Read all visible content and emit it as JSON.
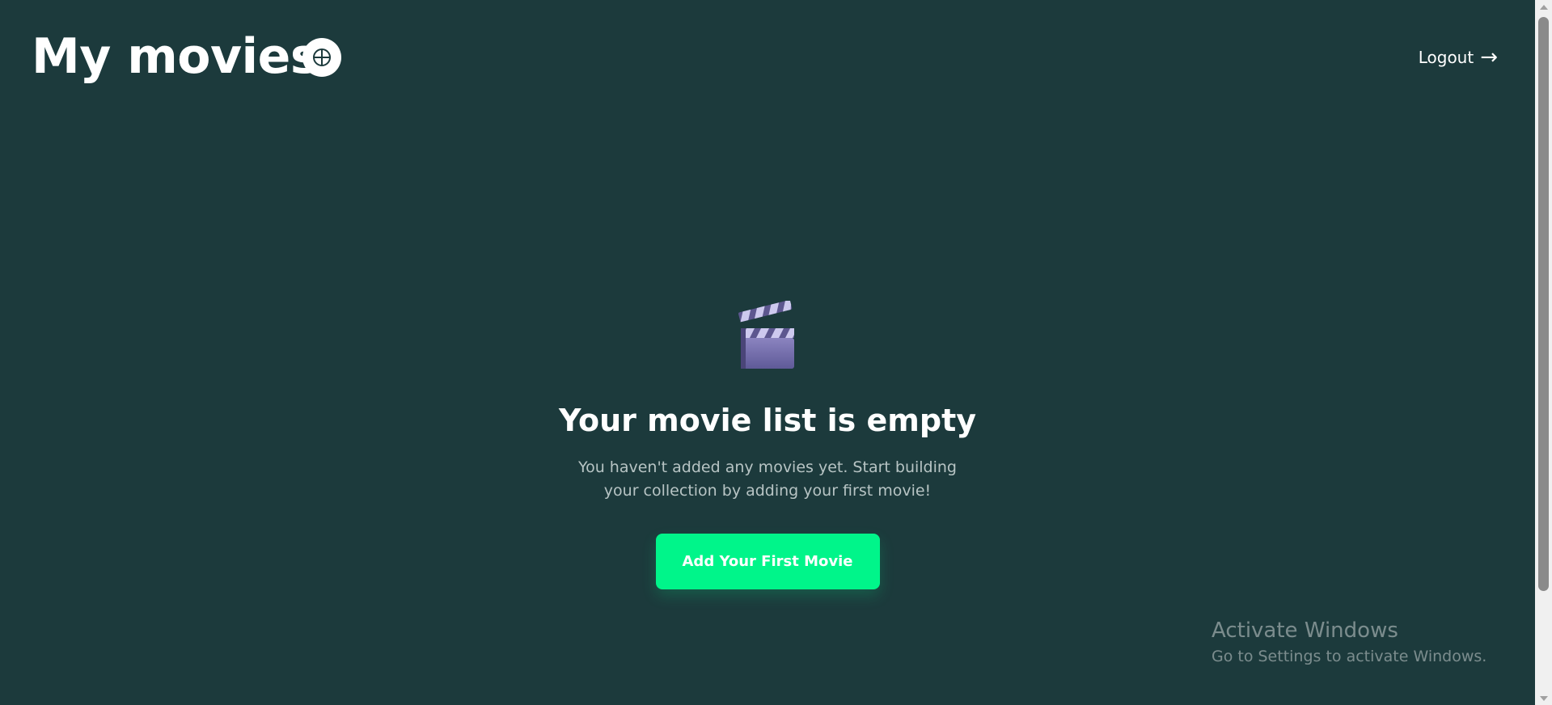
{
  "header": {
    "title": "My movies",
    "add_icon": "plus-circle-icon",
    "logout_label": "Logout",
    "logout_arrow": "→"
  },
  "empty_state": {
    "icon": "clapper-board-icon",
    "heading": "Your movie list is empty",
    "description": "You haven't added any movies yet. Start building your collection by adding your first movie!",
    "cta_label": "Add Your First Movie"
  },
  "watermark": {
    "title": "Activate Windows",
    "subtitle": "Go to Settings to activate Windows."
  },
  "colors": {
    "background": "#1c3a3c",
    "accent": "#00f58a",
    "text_primary": "#ffffff",
    "text_secondary": "#b7c4c4"
  }
}
